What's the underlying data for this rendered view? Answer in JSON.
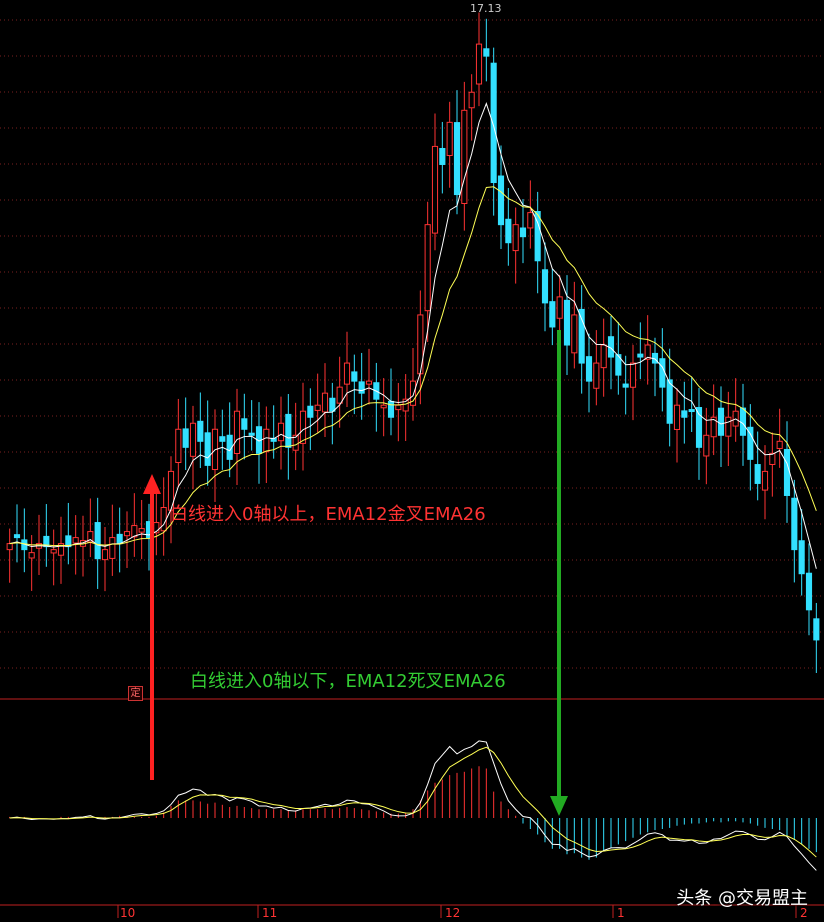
{
  "annotations": {
    "golden_cross": "白线进入0轴以上，EMA12金叉EMA26",
    "death_cross": "白线进入0轴以下，EMA12死叉EMA26"
  },
  "watermark": "头条 @交易盟主",
  "badge": "定",
  "colors": {
    "background": "#000000",
    "up": "#ff3333",
    "down": "#33e0ff",
    "ma_fast": "#ffffff",
    "ma_slow": "#ffff55",
    "grid": "#7a1f1f",
    "arrow_up": "#ff2222",
    "arrow_down": "#22aa22"
  },
  "chart_data": {
    "type": "candlestick+macd",
    "max_label": "17.13",
    "x_ticks": [
      "10",
      "11",
      "12",
      "1",
      "2"
    ],
    "price_close": [
      8.6,
      8.7,
      8.5,
      8.45,
      8.6,
      8.55,
      8.5,
      8.6,
      8.55,
      8.7,
      8.65,
      8.8,
      8.35,
      8.5,
      8.7,
      8.6,
      8.8,
      8.9,
      8.85,
      8.7,
      8.95,
      9.2,
      9.8,
      10.5,
      10.2,
      10.6,
      10.3,
      9.9,
      10.5,
      10.3,
      10.0,
      10.8,
      10.5,
      10.4,
      10.1,
      10.5,
      10.3,
      10.6,
      10.2,
      10.4,
      10.8,
      10.7,
      10.9,
      11.1,
      10.8,
      11.2,
      11.6,
      11.3,
      11.1,
      11.3,
      11.0,
      10.9,
      10.7,
      10.9,
      11.0,
      11.3,
      12.4,
      13.9,
      15.2,
      14.9,
      15.6,
      14.4,
      15.8,
      16.1,
      16.9,
      16.7,
      14.6,
      13.9,
      13.6,
      13.9,
      13.7,
      14.1,
      13.3,
      12.6,
      12.2,
      12.7,
      11.9,
      12.4,
      11.6,
      11.3,
      11.6,
      11.9,
      11.7,
      11.4,
      11.2,
      11.6,
      11.7,
      11.9,
      11.6,
      11.2,
      10.6,
      10.9,
      10.7,
      10.8,
      10.2,
      10.4,
      10.7,
      10.4,
      10.7,
      10.8,
      10.4,
      10.0,
      9.6,
      9.8,
      10.1,
      10.3,
      9.4,
      8.5,
      8.1,
      7.5,
      7.0
    ],
    "macd_hist": [
      0.01,
      0.01,
      0.01,
      0.0,
      0.0,
      0.0,
      0.0,
      0.01,
      0.01,
      0.01,
      0.0,
      0.0,
      0.0,
      0.01,
      0.01,
      0.02,
      0.01,
      0.01,
      0.01,
      0.01,
      0.02,
      0.05,
      0.11,
      0.16,
      0.16,
      0.16,
      0.15,
      0.13,
      0.14,
      0.12,
      0.1,
      0.11,
      0.1,
      0.09,
      0.08,
      0.08,
      0.08,
      0.08,
      0.07,
      0.07,
      0.08,
      0.08,
      0.08,
      0.09,
      0.08,
      0.09,
      0.1,
      0.09,
      0.08,
      0.07,
      0.06,
      0.05,
      0.04,
      0.04,
      0.05,
      0.08,
      0.16,
      0.25,
      0.32,
      0.35,
      0.39,
      0.41,
      0.42,
      0.45,
      0.47,
      0.45,
      0.24,
      0.15,
      0.08,
      0.02,
      -0.05,
      -0.1,
      -0.15,
      -0.22,
      -0.28,
      -0.28,
      -0.33,
      -0.32,
      -0.36,
      -0.38,
      -0.36,
      -0.3,
      -0.27,
      -0.24,
      -0.21,
      -0.18,
      -0.15,
      -0.13,
      -0.11,
      -0.1,
      -0.09,
      -0.07,
      -0.06,
      -0.05,
      -0.05,
      -0.04,
      -0.03,
      -0.04,
      -0.03,
      -0.03,
      -0.04,
      -0.05,
      -0.07,
      -0.09,
      -0.1,
      -0.11,
      -0.16,
      -0.2,
      -0.24,
      -0.28,
      -0.31
    ]
  }
}
